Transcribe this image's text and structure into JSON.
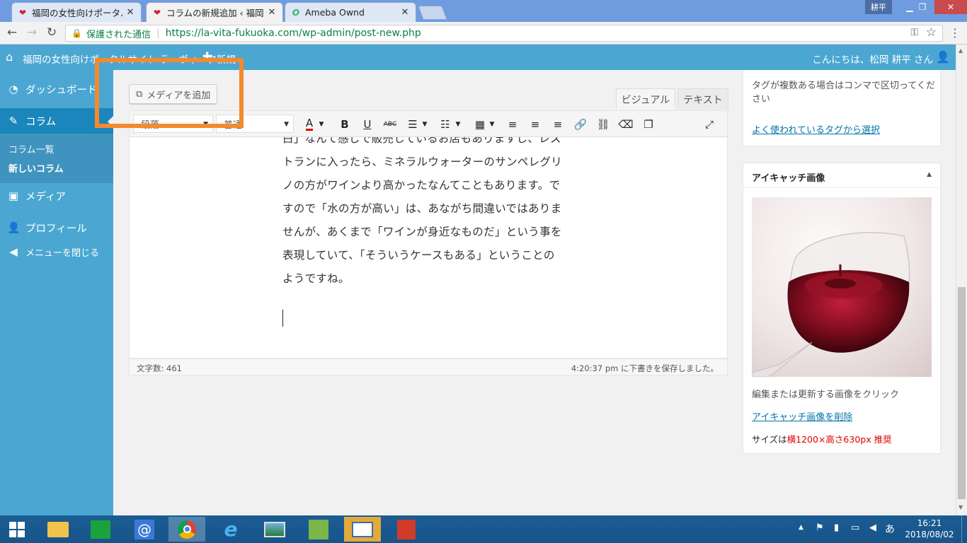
{
  "browser": {
    "tabs": [
      {
        "title": "福岡の女性向けポータルサイ"
      },
      {
        "title": "コラムの新規追加 ‹ 福岡の"
      },
      {
        "title": "Ameba Ownd"
      }
    ],
    "user_badge": "耕平",
    "secure_label": "保護された通信",
    "url": "https://la-vita-fukuoka.com/wp-admin/post-new.php"
  },
  "adminbar": {
    "site_name": "福岡の女性向けポータルサイト ラ・ヴィータ",
    "new_label": "新規",
    "greeting": "こんにちは、松岡 耕平 さん"
  },
  "sidebar": {
    "dashboard": "ダッシュボード",
    "column": "コラム",
    "column_list": "コラム一覧",
    "new_column": "新しいコラム",
    "media": "メディア",
    "profile": "プロフィール",
    "collapse": "メニューを閉じる"
  },
  "editor": {
    "add_media": "メディアを追加",
    "tab_visual": "ビジュアル",
    "tab_text": "テキスト",
    "format_select": "段落",
    "font_select": "普通",
    "lines": [
      "白」なんて感じで販売しているお店もありますし、レス",
      "トランに入ったら、ミネラルウォーターのサンペレグリ",
      "ノの方がワインより高かったなんてこともあります。で",
      "すので「水の方が高い」は、あながち間違いではありま",
      "せんが、あくまで「ワインが身近なものだ」という事を",
      "表現していて、「そういうケースもある」ということの",
      "ようですね。"
    ],
    "word_count": "文字数: 461",
    "draft_saved": "4:20:37 pm に下書きを保存しました。"
  },
  "tags_box": {
    "hint": "タグが複数ある場合はコンマで区切ってください",
    "choose_link": "よく使われているタグから選択"
  },
  "featured_image": {
    "title": "アイキャッチ画像",
    "click_hint": "編集または更新する画像をクリック",
    "remove_link": "アイキャッチ画像を削除",
    "size_prefix": "サイズは",
    "size_value": "横1200×高さ630px 推奨"
  },
  "taskbar": {
    "ime": "あ",
    "time": "16:21",
    "date": "2018/08/02"
  },
  "colors": {
    "wp_blue": "#4ba7d2",
    "highlight": "#f5892d",
    "link": "#0073aa",
    "warning_red": "#dd0000"
  }
}
